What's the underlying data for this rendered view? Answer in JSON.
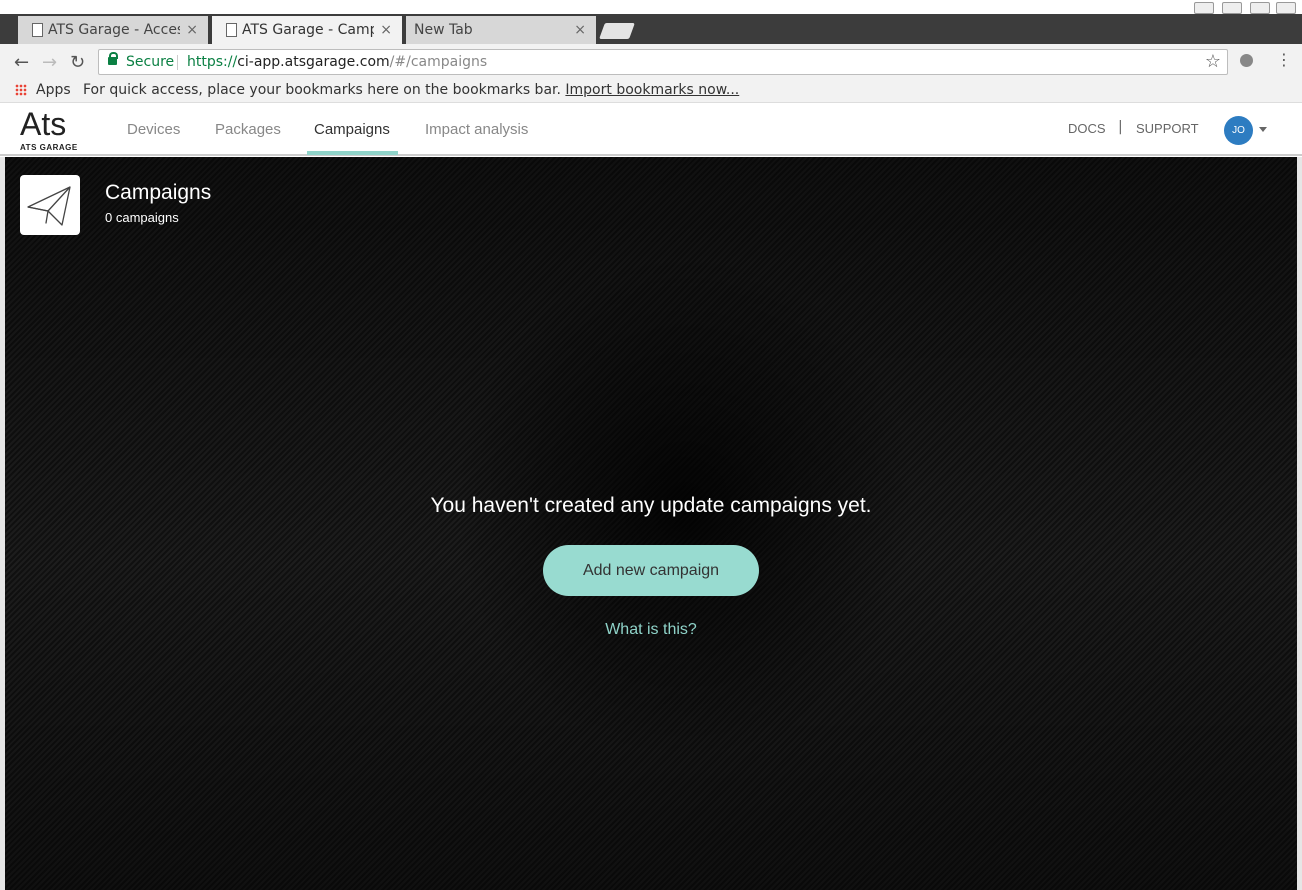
{
  "browser": {
    "tabs": [
      {
        "title": "ATS Garage - Access",
        "active": false
      },
      {
        "title": "ATS Garage - Campa",
        "active": true
      },
      {
        "title": "New Tab",
        "active": false
      }
    ],
    "secure_label": "Secure",
    "url_proto": "https://",
    "url_host": "ci-app.atsgarage.com",
    "url_path": "/#/campaigns",
    "bookmarks": {
      "apps": "Apps",
      "message": "For quick access, place your bookmarks here on the bookmarks bar.",
      "import_link": "Import bookmarks now..."
    }
  },
  "app": {
    "logo": "Ats",
    "logo_sub": "ATS GARAGE",
    "nav": [
      "Devices",
      "Packages",
      "Campaigns",
      "Impact analysis"
    ],
    "active_nav": "Campaigns",
    "docs": "DOCS",
    "pipe": "|",
    "support": "SUPPORT",
    "avatar_initials": "JO",
    "accent": "#8fd3c9",
    "avatar_color": "#2d7cc1"
  },
  "page": {
    "title": "Campaigns",
    "subtitle": "0 campaigns",
    "empty_message": "You haven't created any update campaigns yet.",
    "add_button": "Add new campaign",
    "help_link": "What is this?",
    "icon": "paper-plane-icon"
  }
}
